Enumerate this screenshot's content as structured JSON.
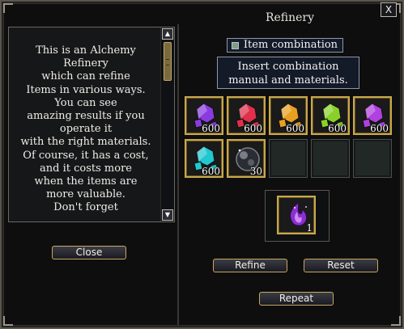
{
  "window": {
    "title": "Refinery",
    "close_glyph": "X"
  },
  "left_panel": {
    "description": "This is an Alchemy\nRefinery\nwhich can refine\nItems in various ways.\nYou can see\namazing results if you\noperate it\nwith the right materials.\nOf course, it has a cost,\nand it costs more\nwhen the items are\nmore valuable.\nDon't forget",
    "scroll_up_glyph": "▲",
    "scroll_down_glyph": "▼",
    "close_label": "Close"
  },
  "right_panel": {
    "combination_label": "Item combination",
    "instruction": "Insert combination\nmanual and materials.",
    "slots": [
      {
        "item": "purple-crystal-icon",
        "color": "#8a3be0",
        "qty": "600"
      },
      {
        "item": "red-crystal-icon",
        "color": "#e0304a",
        "qty": "600"
      },
      {
        "item": "orange-crystal-icon",
        "color": "#e8a020",
        "qty": "600"
      },
      {
        "item": "green-crystal-icon",
        "color": "#8ad02a",
        "qty": "600"
      },
      {
        "item": "violet-crystal-icon",
        "color": "#b040e0",
        "qty": "600"
      },
      {
        "item": "cyan-crystal-icon",
        "color": "#20c8d0",
        "qty": "600"
      },
      {
        "item": "dark-orb-icon",
        "color": "#8a8e96",
        "qty": "30"
      },
      {
        "item": "empty",
        "qty": ""
      },
      {
        "item": "empty",
        "qty": ""
      },
      {
        "item": "empty",
        "qty": ""
      }
    ],
    "result": {
      "item": "purple-flame-manual-icon",
      "color": "#9a3ad8",
      "qty": "1"
    },
    "refine_label": "Refine",
    "reset_label": "Reset",
    "repeat_label": "Repeat"
  }
}
